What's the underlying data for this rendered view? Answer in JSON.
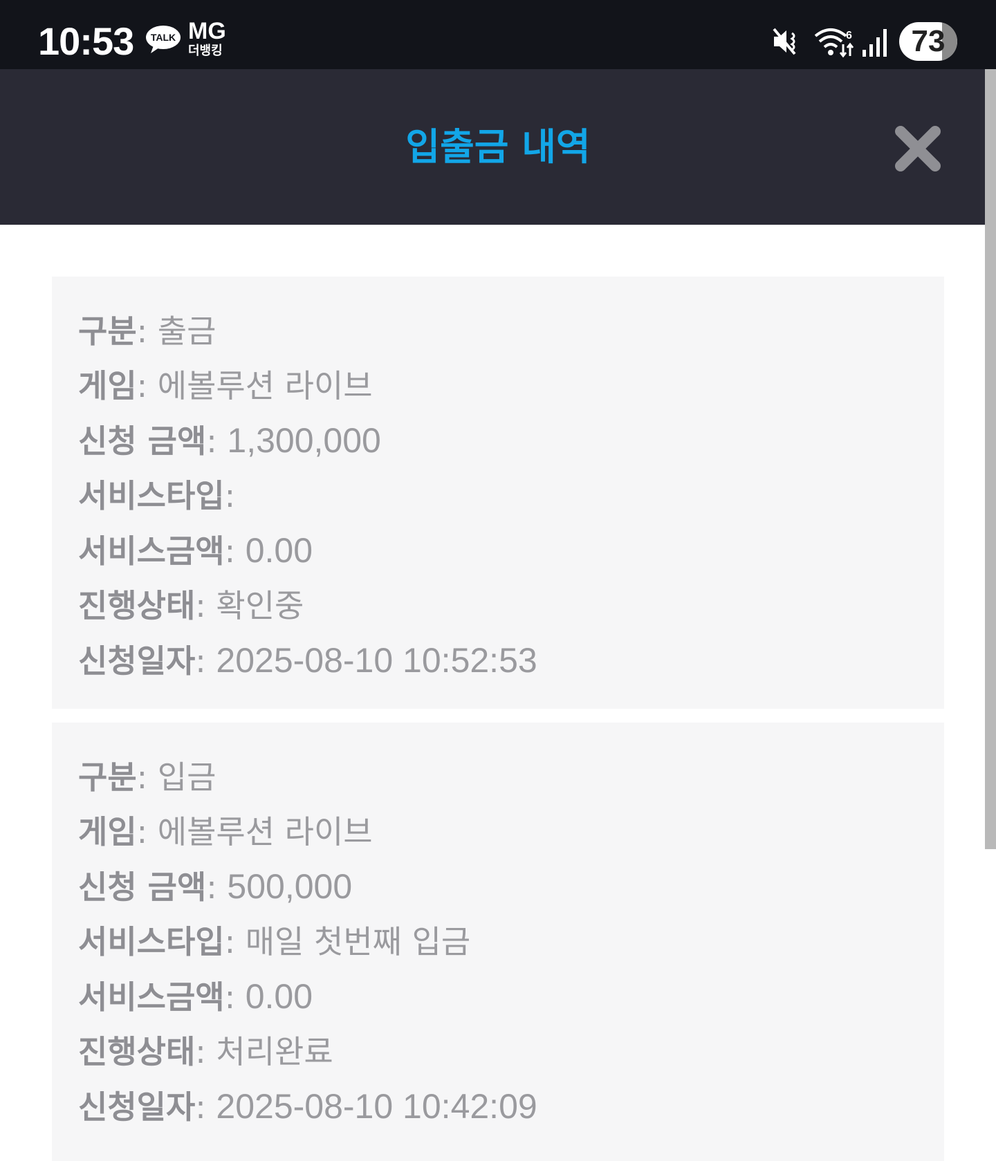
{
  "status_bar": {
    "time": "10:53",
    "talk_badge": "TALK",
    "mg_top": "MG",
    "mg_bottom": "더뱅킹",
    "battery": "73",
    "icons": [
      "talk-icon",
      "mute-icon",
      "wifi-icon",
      "signal-icon",
      "battery-icon"
    ]
  },
  "header": {
    "title": "입출금 내역",
    "accent_color": "#12a6e8",
    "close_icon": "close-icon"
  },
  "records": [
    {
      "fields": [
        {
          "label": "구분",
          "sep": ": ",
          "value": "출금"
        },
        {
          "label": "게임",
          "sep": ": ",
          "value": "에볼루션 라이브"
        },
        {
          "label": "신청 금액",
          "sep": ": ",
          "value": "1,300,000"
        },
        {
          "label": "서비스타입",
          "sep": ":",
          "value": ""
        },
        {
          "label": "서비스금액",
          "sep": ": ",
          "value": "0.00"
        },
        {
          "label": "진행상태",
          "sep": ": ",
          "value": "확인중"
        },
        {
          "label": "신청일자",
          "sep": ": ",
          "value": "2025-08-10 10:52:53"
        }
      ]
    },
    {
      "fields": [
        {
          "label": "구분",
          "sep": ": ",
          "value": "입금"
        },
        {
          "label": "게임",
          "sep": ": ",
          "value": "에볼루션 라이브"
        },
        {
          "label": "신청 금액",
          "sep": ": ",
          "value": "500,000"
        },
        {
          "label": "서비스타입",
          "sep": ": ",
          "value": "매일 첫번째 입금"
        },
        {
          "label": "서비스금액",
          "sep": ": ",
          "value": "0.00"
        },
        {
          "label": "진행상태",
          "sep": ": ",
          "value": "처리완료"
        },
        {
          "label": "신청일자",
          "sep": ": ",
          "value": "2025-08-10 10:42:09"
        }
      ]
    }
  ]
}
